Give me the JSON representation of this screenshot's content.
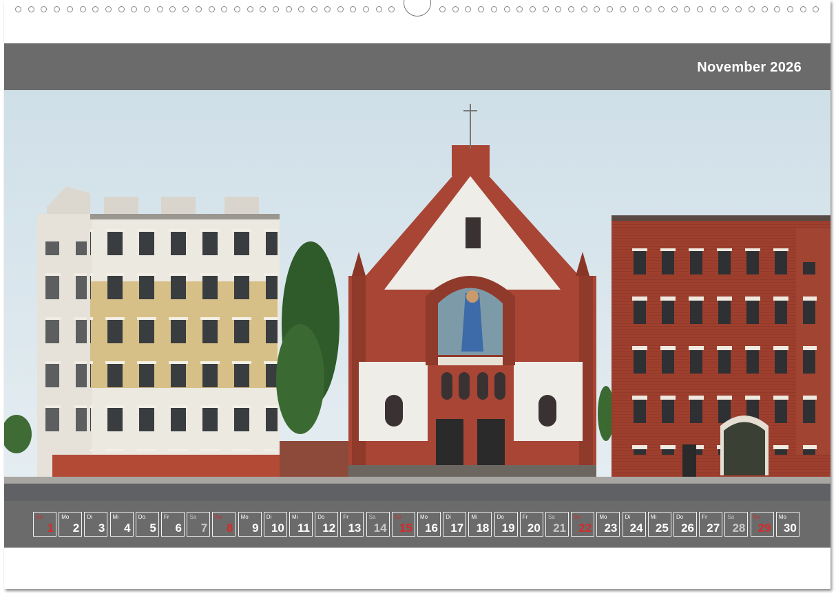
{
  "calendar": {
    "month_title": "November 2026",
    "days": [
      {
        "dow": "So",
        "num": "1",
        "type": "sun"
      },
      {
        "dow": "Mo",
        "num": "2",
        "type": "weekday"
      },
      {
        "dow": "Di",
        "num": "3",
        "type": "weekday"
      },
      {
        "dow": "Mi",
        "num": "4",
        "type": "weekday"
      },
      {
        "dow": "Do",
        "num": "5",
        "type": "weekday"
      },
      {
        "dow": "Fr",
        "num": "6",
        "type": "weekday"
      },
      {
        "dow": "Sa",
        "num": "7",
        "type": "sat"
      },
      {
        "dow": "So",
        "num": "8",
        "type": "sun"
      },
      {
        "dow": "Mo",
        "num": "9",
        "type": "weekday"
      },
      {
        "dow": "Di",
        "num": "10",
        "type": "weekday"
      },
      {
        "dow": "Mi",
        "num": "11",
        "type": "weekday"
      },
      {
        "dow": "Do",
        "num": "12",
        "type": "weekday"
      },
      {
        "dow": "Fr",
        "num": "13",
        "type": "weekday"
      },
      {
        "dow": "Sa",
        "num": "14",
        "type": "sat"
      },
      {
        "dow": "So",
        "num": "15",
        "type": "sun"
      },
      {
        "dow": "Mo",
        "num": "16",
        "type": "weekday"
      },
      {
        "dow": "Di",
        "num": "17",
        "type": "weekday"
      },
      {
        "dow": "Mi",
        "num": "18",
        "type": "weekday"
      },
      {
        "dow": "Do",
        "num": "19",
        "type": "weekday"
      },
      {
        "dow": "Fr",
        "num": "20",
        "type": "weekday"
      },
      {
        "dow": "Sa",
        "num": "21",
        "type": "sat"
      },
      {
        "dow": "So",
        "num": "22",
        "type": "sun"
      },
      {
        "dow": "Mo",
        "num": "23",
        "type": "weekday"
      },
      {
        "dow": "Di",
        "num": "24",
        "type": "weekday"
      },
      {
        "dow": "Mi",
        "num": "25",
        "type": "weekday"
      },
      {
        "dow": "Do",
        "num": "26",
        "type": "weekday"
      },
      {
        "dow": "Fr",
        "num": "27",
        "type": "weekday"
      },
      {
        "dow": "Sa",
        "num": "28",
        "type": "sat"
      },
      {
        "dow": "So",
        "num": "29",
        "type": "sun"
      },
      {
        "dow": "Mo",
        "num": "30",
        "type": "weekday"
      }
    ]
  },
  "colors": {
    "bar": "#6b6b6b",
    "sunday": "#d42a2a",
    "saturday": "#c8c8c8",
    "brick": "#a0402e",
    "sky": "#d8e6ee"
  },
  "photo": {
    "subject": "street-facade-photo"
  }
}
